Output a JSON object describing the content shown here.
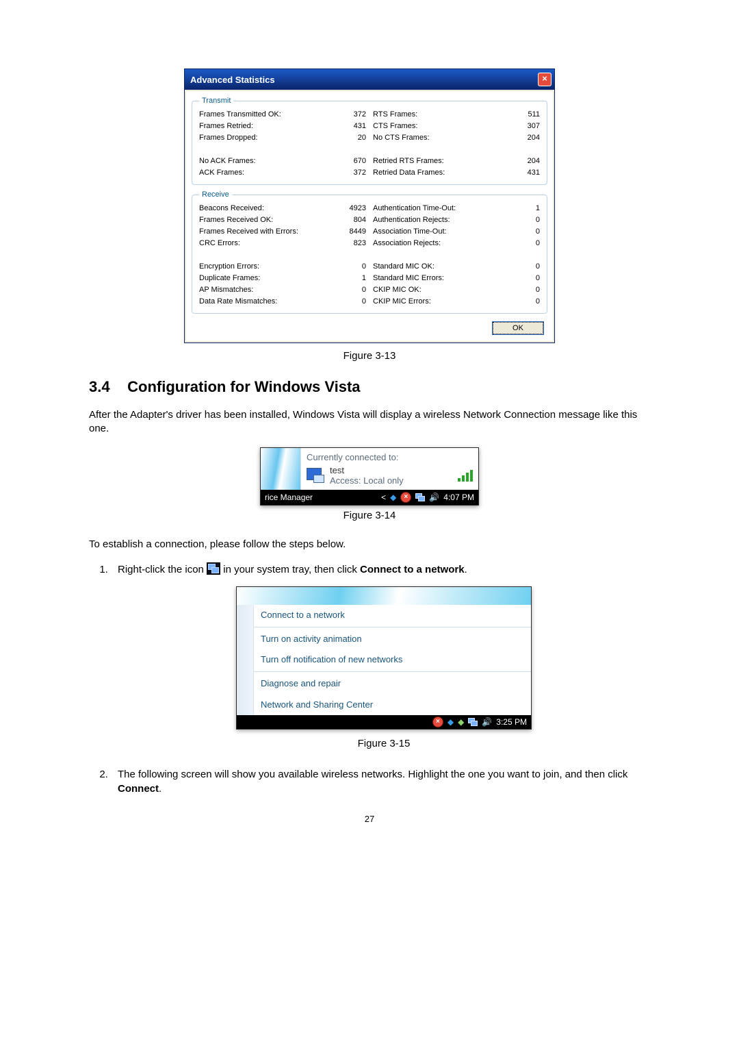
{
  "dialog": {
    "title": "Advanced Statistics",
    "ok": "OK",
    "transmit": {
      "legend": "Transmit",
      "left": [
        {
          "l": "Frames Transmitted OK:",
          "v": "372"
        },
        {
          "l": "Frames Retried:",
          "v": "431"
        },
        {
          "l": "Frames Dropped:",
          "v": "20"
        },
        {
          "l": "",
          "v": ""
        },
        {
          "l": "No ACK Frames:",
          "v": "670"
        },
        {
          "l": "ACK Frames:",
          "v": "372"
        }
      ],
      "right": [
        {
          "l": "RTS Frames:",
          "v": "511"
        },
        {
          "l": "CTS Frames:",
          "v": "307"
        },
        {
          "l": "No CTS Frames:",
          "v": "204"
        },
        {
          "l": "",
          "v": ""
        },
        {
          "l": "Retried RTS Frames:",
          "v": "204"
        },
        {
          "l": "Retried Data Frames:",
          "v": "431"
        }
      ]
    },
    "receive": {
      "legend": "Receive",
      "left": [
        {
          "l": "Beacons Received:",
          "v": "4923"
        },
        {
          "l": "Frames Received OK:",
          "v": "804"
        },
        {
          "l": "Frames Received with Errors:",
          "v": "8449"
        },
        {
          "l": "CRC Errors:",
          "v": "823"
        },
        {
          "l": "",
          "v": ""
        },
        {
          "l": "Encryption Errors:",
          "v": "0"
        },
        {
          "l": "Duplicate Frames:",
          "v": "1"
        },
        {
          "l": "AP Mismatches:",
          "v": "0"
        },
        {
          "l": "Data Rate Mismatches:",
          "v": "0"
        }
      ],
      "right": [
        {
          "l": "Authentication Time-Out:",
          "v": "1"
        },
        {
          "l": "Authentication Rejects:",
          "v": "0"
        },
        {
          "l": "Association Time-Out:",
          "v": "0"
        },
        {
          "l": "Association Rejects:",
          "v": "0"
        },
        {
          "l": "",
          "v": ""
        },
        {
          "l": "Standard MIC OK:",
          "v": "0"
        },
        {
          "l": "Standard MIC Errors:",
          "v": "0"
        },
        {
          "l": "CKIP MIC OK:",
          "v": "0"
        },
        {
          "l": "CKIP MIC Errors:",
          "v": "0"
        }
      ]
    }
  },
  "captions": {
    "f13": "Figure 3-13",
    "f14": "Figure 3-14",
    "f15": "Figure 3-15"
  },
  "section": {
    "num": "3.4",
    "title": "Configuration for Windows Vista"
  },
  "paras": {
    "intro": "After the Adapter's driver has been installed, Windows Vista will display a wireless Network Connection message like this one.",
    "establish": "To establish a connection, please follow the steps below."
  },
  "vista_popup": {
    "heading": "Currently connected to:",
    "name": "test",
    "access": "Access:  Local only",
    "task_left": "rice Manager",
    "time": "4:07 PM"
  },
  "steps": {
    "s1a": "Right-click the icon",
    "s1b": " in your system tray, then click ",
    "s1c": "Connect to a network",
    "s1d": ".",
    "s2a": "The following screen will show you available wireless networks. Highlight the one you want to join, and then click ",
    "s2b": "Connect",
    "s2c": "."
  },
  "context": {
    "items": [
      "Connect to a network",
      "Turn on activity animation",
      "Turn off notification of new networks",
      "Diagnose and repair",
      "Network and Sharing Center"
    ],
    "time": "3:25 PM"
  },
  "page_number": "27"
}
